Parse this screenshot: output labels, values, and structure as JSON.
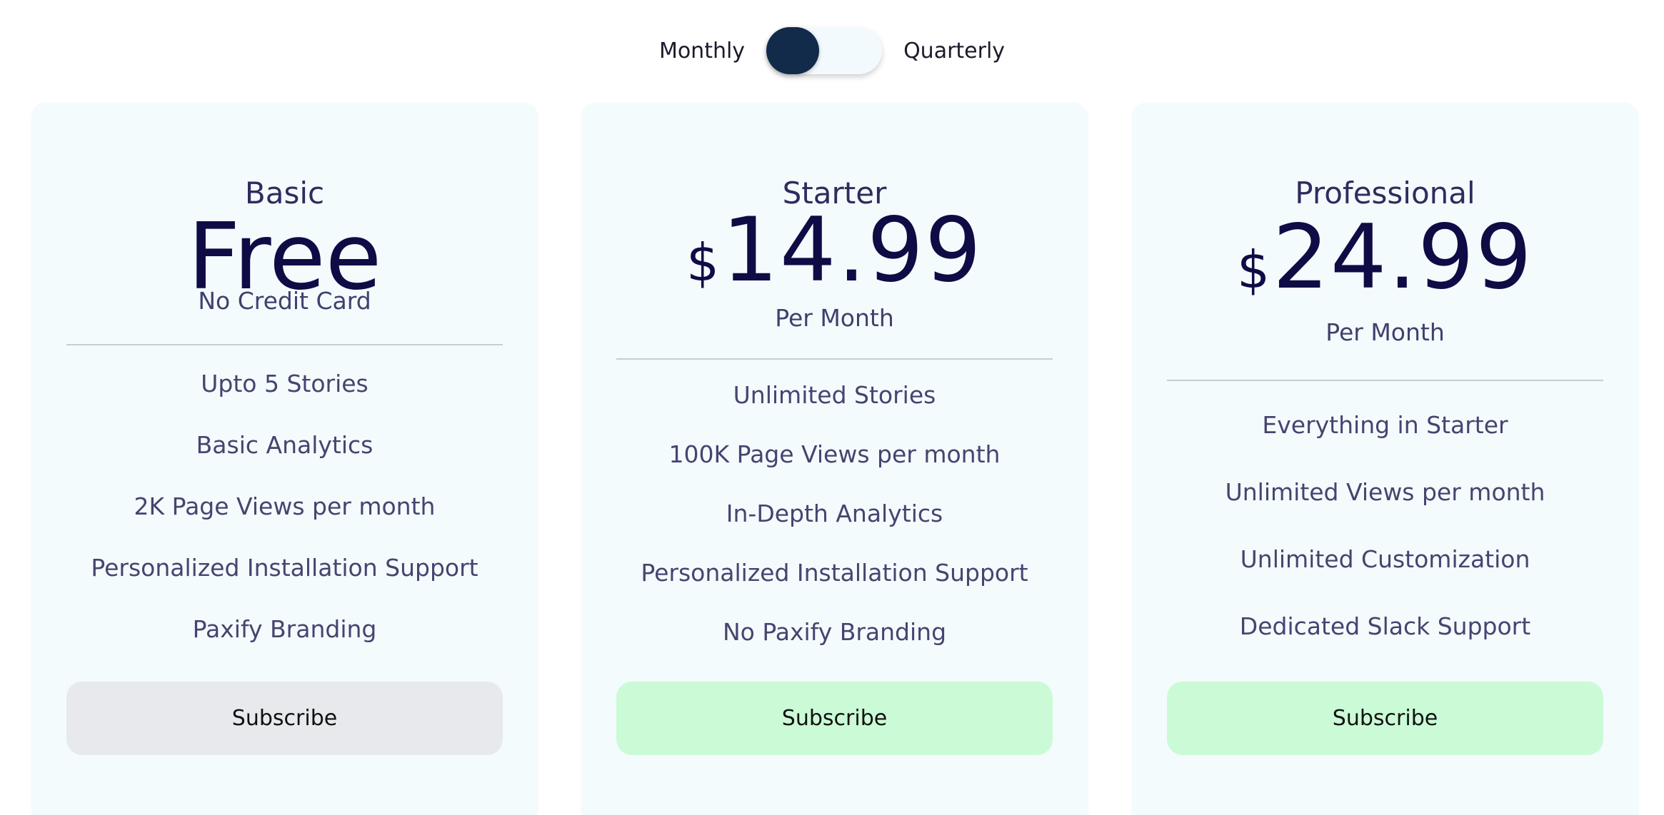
{
  "billing_toggle": {
    "left_label": "Monthly",
    "right_label": "Quarterly",
    "selected": "Monthly"
  },
  "colors": {
    "card_background": "#f3fbfd",
    "heading": "#0f0b45",
    "text": "#46446f",
    "toggle_knob": "#122b4a",
    "button_basic": "#e8e9ec",
    "button_paid": "#cafbd6"
  },
  "plans": [
    {
      "name": "Basic",
      "price": "Free",
      "price_note": "No Credit Card",
      "features": [
        "Upto 5 Stories",
        "Basic Analytics",
        "2K Page Views per month",
        "Personalized Installation Support",
        "Paxify Branding"
      ],
      "button_label": "Subscribe"
    },
    {
      "name": "Starter",
      "currency": "$",
      "price": "14.99",
      "price_note": "Per Month",
      "features": [
        "Unlimited Stories",
        "100K Page Views per month",
        "In-Depth Analytics",
        "Personalized Installation Support",
        "No Paxify Branding"
      ],
      "button_label": "Subscribe"
    },
    {
      "name": "Professional",
      "currency": "$",
      "price": "24.99",
      "price_note": "Per Month",
      "features": [
        "Everything in Starter",
        "Unlimited Views per month",
        "Unlimited Customization",
        "Dedicated Slack Support"
      ],
      "button_label": "Subscribe"
    }
  ]
}
